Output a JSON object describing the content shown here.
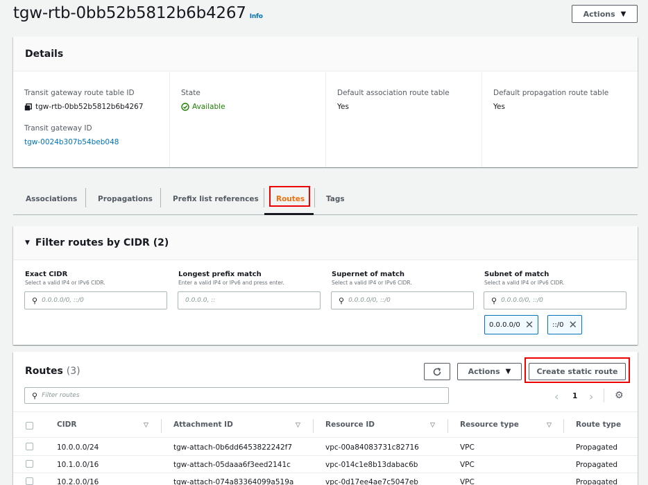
{
  "page": {
    "title": "tgw-rtb-0bb52b5812b6b4267",
    "info_label": "Info",
    "actions_label": "Actions"
  },
  "details": {
    "heading": "Details",
    "route_table_id_label": "Transit gateway route table ID",
    "route_table_id_value": "tgw-rtb-0bb52b5812b6b4267",
    "transit_gateway_id_label": "Transit gateway ID",
    "transit_gateway_id_value": "tgw-0024b307b54beb048",
    "state_label": "State",
    "state_value": "Available",
    "default_association_label": "Default association route table",
    "default_association_value": "Yes",
    "default_propagation_label": "Default propagation route table",
    "default_propagation_value": "Yes"
  },
  "tabs": [
    "Associations",
    "Propagations",
    "Prefix list references",
    "Routes",
    "Tags"
  ],
  "active_tab": "Routes",
  "filter": {
    "heading": "Filter routes by CIDR (2)",
    "fields": [
      {
        "label": "Exact CIDR",
        "hint": "Select a valid IP4 or IPv6 CIDR.",
        "placeholder": "0.0.0.0/0, ::/0"
      },
      {
        "label": "Longest prefix match",
        "hint": "Enter a valid IP4 or IPv6 and press enter.",
        "placeholder": "0.0.0.0, ::"
      },
      {
        "label": "Supernet of match",
        "hint": "Select a valid IP4 or IPv6 CIDR.",
        "placeholder": "0.0.0.0/0, ::/0"
      },
      {
        "label": "Subnet of match",
        "hint": "Select a valid IP4 or IPv6 CIDR.",
        "placeholder": "0.0.0.0/0, ::/0"
      }
    ],
    "tokens": [
      "0.0.0.0/0",
      "::/0"
    ]
  },
  "routes": {
    "heading": "Routes",
    "count": "(3)",
    "actions_label": "Actions",
    "create_label": "Create static route",
    "search_placeholder": "Filter routes",
    "page_number": "1",
    "columns": [
      "CIDR",
      "Attachment ID",
      "Resource ID",
      "Resource type",
      "Route type"
    ],
    "rows": [
      {
        "cidr": "10.0.0.0/24",
        "attachment": "tgw-attach-0b6dd6453822242f7",
        "resource": "vpc-00a84083731c82716",
        "resource_type": "VPC",
        "route_type": "Propagated"
      },
      {
        "cidr": "10.1.0.0/16",
        "attachment": "tgw-attach-05daaa6f3eed2141c",
        "resource": "vpc-014c1e8b13dabac6b",
        "resource_type": "VPC",
        "route_type": "Propagated"
      },
      {
        "cidr": "10.2.0.0/16",
        "attachment": "tgw-attach-074a83364099a519a",
        "resource": "vpc-0d17ee4ae7c5047eb",
        "resource_type": "VPC",
        "route_type": "Propagated"
      }
    ]
  },
  "colors": {
    "link": "#0073bb",
    "accent": "#ec7211",
    "success": "#1d8102",
    "highlight": "#e00000"
  }
}
